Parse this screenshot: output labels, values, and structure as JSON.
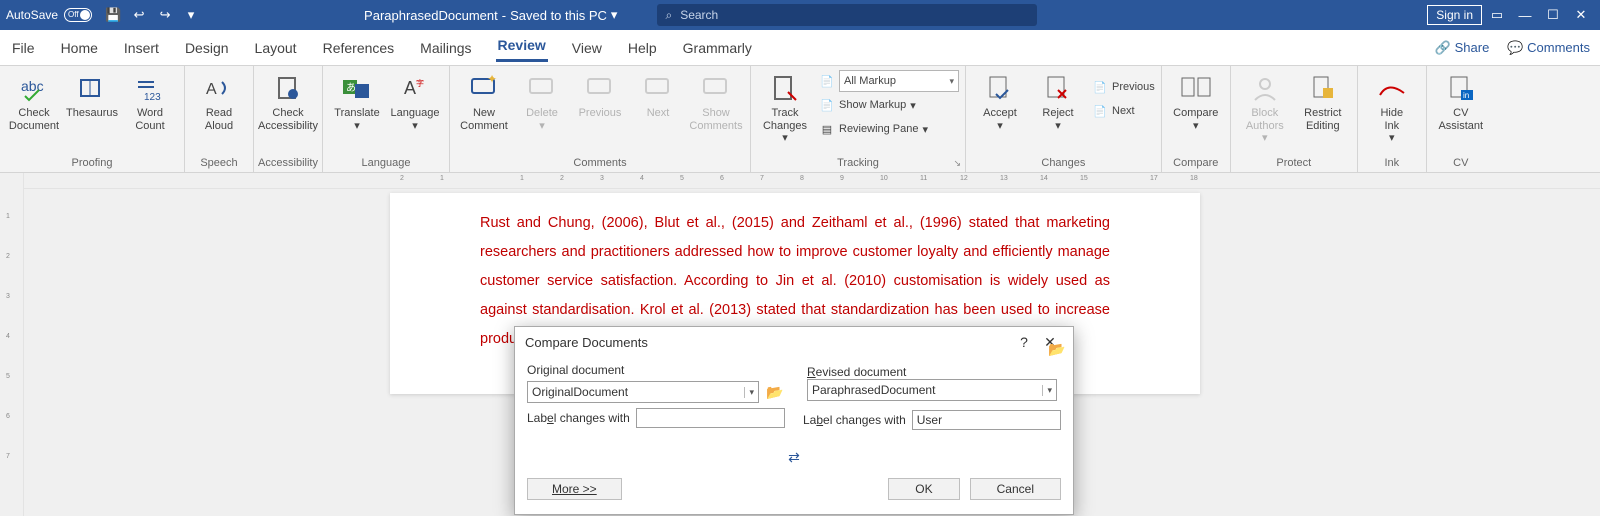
{
  "titlebar": {
    "autosave": "AutoSave",
    "autosave_state": "Off",
    "doc_name": "ParaphrasedDocument",
    "saved_state": "Saved to this PC",
    "search_placeholder": "Search",
    "signin": "Sign in"
  },
  "tabs": [
    "File",
    "Home",
    "Insert",
    "Design",
    "Layout",
    "References",
    "Mailings",
    "Review",
    "View",
    "Help",
    "Grammarly"
  ],
  "active_tab": "Review",
  "share": "Share",
  "comments": "Comments",
  "ribbon": {
    "proofing": {
      "label": "Proofing",
      "check_doc": "Check\nDocument",
      "thesaurus": "Thesaurus",
      "word_count": "Word\nCount"
    },
    "speech": {
      "label": "Speech",
      "read_aloud": "Read\nAloud"
    },
    "accessibility": {
      "label": "Accessibility",
      "check": "Check\nAccessibility"
    },
    "language": {
      "label": "Language",
      "translate": "Translate",
      "lang": "Language"
    },
    "comments": {
      "label": "Comments",
      "new": "New\nComment",
      "delete": "Delete",
      "prev": "Previous",
      "next": "Next",
      "show": "Show\nComments"
    },
    "tracking": {
      "label": "Tracking",
      "track": "Track\nChanges",
      "markup_mode": "All Markup",
      "show_markup": "Show Markup",
      "reviewing_pane": "Reviewing Pane"
    },
    "changes": {
      "label": "Changes",
      "accept": "Accept",
      "reject": "Reject",
      "previous": "Previous",
      "next": "Next"
    },
    "compare": {
      "label": "Compare",
      "compare": "Compare"
    },
    "protect": {
      "label": "Protect",
      "block": "Block\nAuthors",
      "restrict": "Restrict\nEditing"
    },
    "ink": {
      "label": "Ink",
      "hide": "Hide\nInk"
    },
    "cv": {
      "label": "CV",
      "assistant": "CV\nAssistant"
    }
  },
  "document_text": "Rust and Chung, (2006), Blut et al., (2015) and Zeithaml et al., (1996) stated that marketing researchers and practitioners addressed how to improve customer loyalty and efficiently manage customer service satisfaction. According to Jin et al. (2010) customisation is widely used as against standardisation. Krol et al. (2013) stated that standardization has been used to increase productivity, reduce cost. It also incre                                                                                                                                                                 akes it possi                                                                                                                                                                  ps are tailor",
  "dialog": {
    "title": "Compare Documents",
    "original_label": "Original document",
    "original_value": "OriginalDocument",
    "revised_label": "Revised document",
    "revised_value": "ParaphrasedDocument",
    "label_changes": "Label changes with",
    "label_changes_original": "",
    "label_changes_revised": "User",
    "more": "More >>",
    "ok": "OK",
    "cancel": "Cancel"
  },
  "ruler_h": [
    "2",
    "1",
    "",
    "1",
    "2",
    "3",
    "4",
    "5",
    "6",
    "7",
    "8",
    "9",
    "10",
    "11",
    "12",
    "13",
    "14",
    "15",
    "",
    "17",
    "18"
  ],
  "ruler_v": [
    "",
    "1",
    "2",
    "3",
    "4",
    "5",
    "6",
    "7"
  ]
}
